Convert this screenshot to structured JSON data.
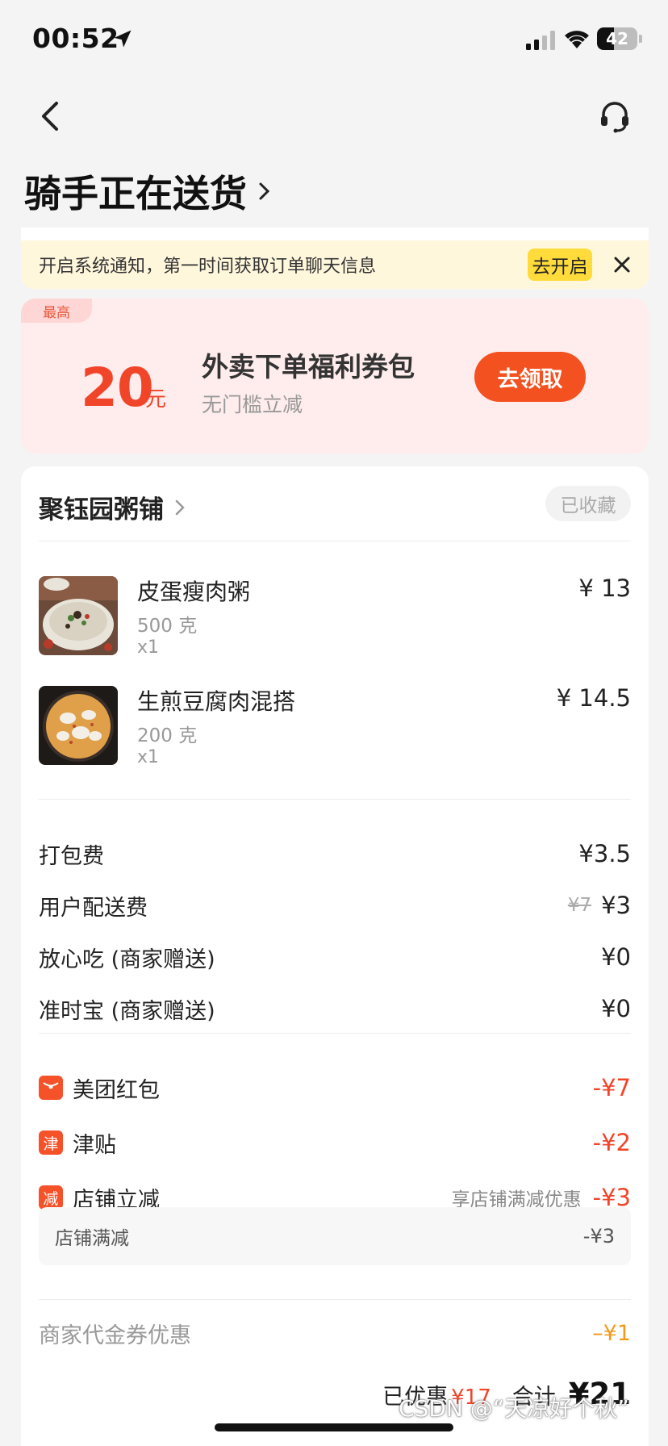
{
  "status_bar": {
    "time": "00:52",
    "battery": "42",
    "battery_level": 0.42
  },
  "header": {
    "title": "骑手正在送货"
  },
  "notify": {
    "text": "开启系统通知，第一时间获取订单聊天信息",
    "button": "去开启"
  },
  "coupon": {
    "tag": "最高",
    "amount": "20",
    "unit": "元",
    "title": "外卖下单福利券包",
    "subtitle": "无门槛立减",
    "button": "去领取"
  },
  "shop": {
    "name": "聚钰园粥铺",
    "fav": "已收藏"
  },
  "items": [
    {
      "name": "皮蛋瘦肉粥",
      "spec": "500 克",
      "qty": "x1",
      "price": "¥ 13"
    },
    {
      "name": "生煎豆腐肉混搭",
      "spec": "200 克",
      "qty": "x1",
      "price": "¥ 14.5"
    }
  ],
  "fees": [
    {
      "label": "打包费",
      "orig": "",
      "value": "¥3.5"
    },
    {
      "label": "用户配送费",
      "orig": "¥7",
      "value": "¥3"
    },
    {
      "label": "放心吃 (商家赠送)",
      "orig": "",
      "value": "¥0"
    },
    {
      "label": "准时宝 (商家赠送)",
      "orig": "",
      "value": "¥0"
    }
  ],
  "discounts": [
    {
      "icon": "envelope",
      "label": "美团红包",
      "note": "",
      "value": "-¥7"
    },
    {
      "icon": "津",
      "label": "津贴",
      "note": "",
      "value": "-¥2"
    },
    {
      "icon": "减",
      "label": "店铺立减",
      "note": "享店铺满减优惠",
      "value": "-¥3"
    }
  ],
  "sub_discount": {
    "label": "店铺满减",
    "value": "-¥3"
  },
  "voucher": {
    "label": "商家代金券优惠",
    "value": "–¥1"
  },
  "total": {
    "saved_label": "已优惠",
    "saved_value": "¥17",
    "total_label": "合计",
    "total_value": "¥21"
  },
  "watermark": "CSDN @“天凉好个秋”"
}
